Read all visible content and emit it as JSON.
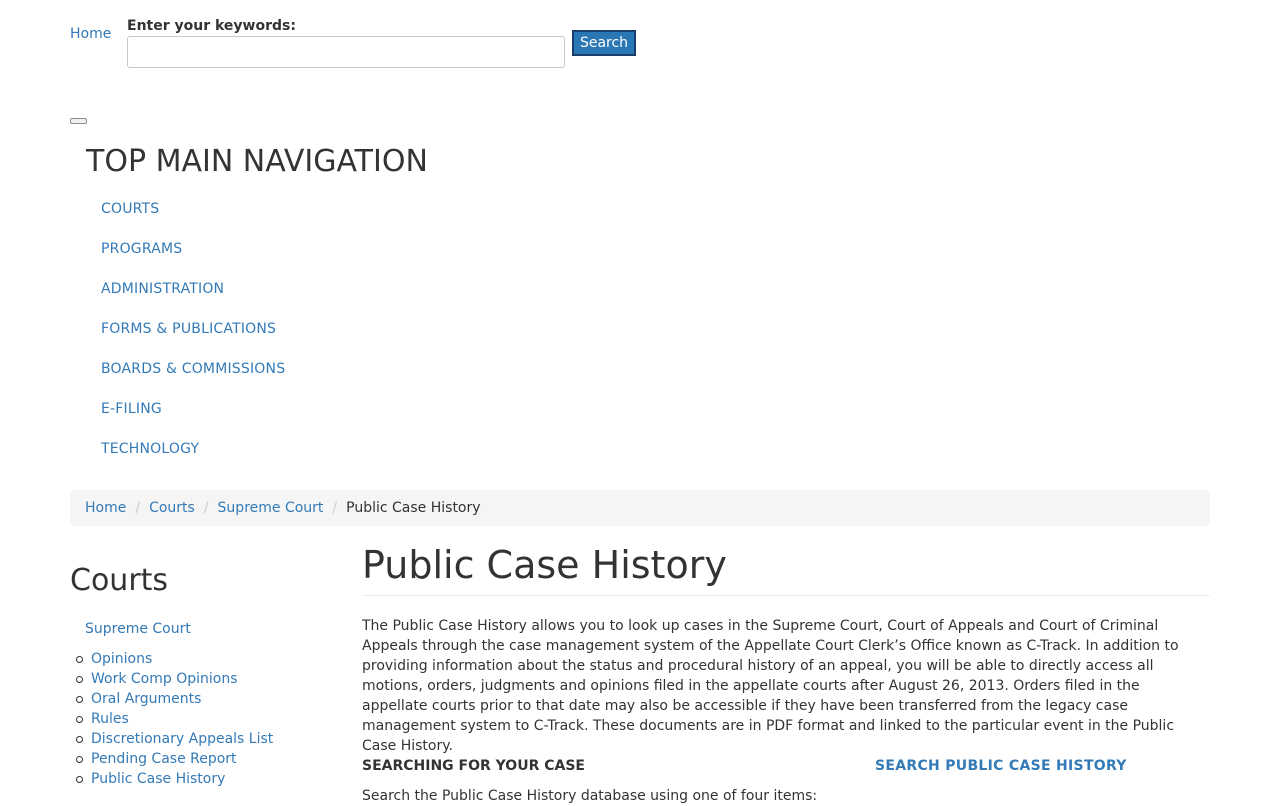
{
  "header": {
    "logo_alt": "Home",
    "keywords_label": "Enter your keywords:",
    "keywords_value": "",
    "search_button": "Search"
  },
  "nav": {
    "heading": "TOP MAIN NAVIGATION",
    "items": [
      {
        "label": "COURTS"
      },
      {
        "label": "PROGRAMS"
      },
      {
        "label": "ADMINISTRATION"
      },
      {
        "label": "FORMS & PUBLICATIONS"
      },
      {
        "label": "BOARDS & COMMISSIONS"
      },
      {
        "label": "E-FILING"
      },
      {
        "label": "TECHNOLOGY"
      }
    ]
  },
  "breadcrumb": {
    "items": [
      "Home",
      "Courts",
      "Supreme Court"
    ],
    "separator": "/",
    "current": "Public Case History"
  },
  "sidebar": {
    "title": "Courts",
    "top_link": "Supreme Court",
    "items": [
      {
        "label": "Opinions"
      },
      {
        "label": "Work Comp Opinions"
      },
      {
        "label": "Oral Arguments"
      },
      {
        "label": "Rules"
      },
      {
        "label": "Discretionary Appeals List"
      },
      {
        "label": "Pending Case Report"
      },
      {
        "label": "Public Case History"
      }
    ]
  },
  "main": {
    "title": "Public Case History",
    "intro": "The Public Case History allows you to look up cases in the Supreme Court, Court of Appeals and Court of Criminal Appeals through the case management system of the Appellate Court Clerk’s Office known as C-Track.  In addition to providing information about the status and procedural history of an appeal, you will be able to directly access all motions, orders, judgments and opinions filed in the appellate courts after August 26, 2013.  Orders filed in the appellate courts prior to that date may also be accessible if they have been transferred from the legacy case management system to C-Track. These documents are in PDF format and linked to the particular event in the Public Case History.",
    "sub_heading": "SEARCHING FOR YOUR CASE",
    "search_link": "SEARCH PUBLIC CASE HISTORY",
    "search_note": "Search the Public Case History database using one of four items:"
  },
  "colors": {
    "link": "#337ab7",
    "text": "#333333",
    "button_bg": "#2a77b5",
    "breadcrumb_bg": "#f5f5f5"
  }
}
